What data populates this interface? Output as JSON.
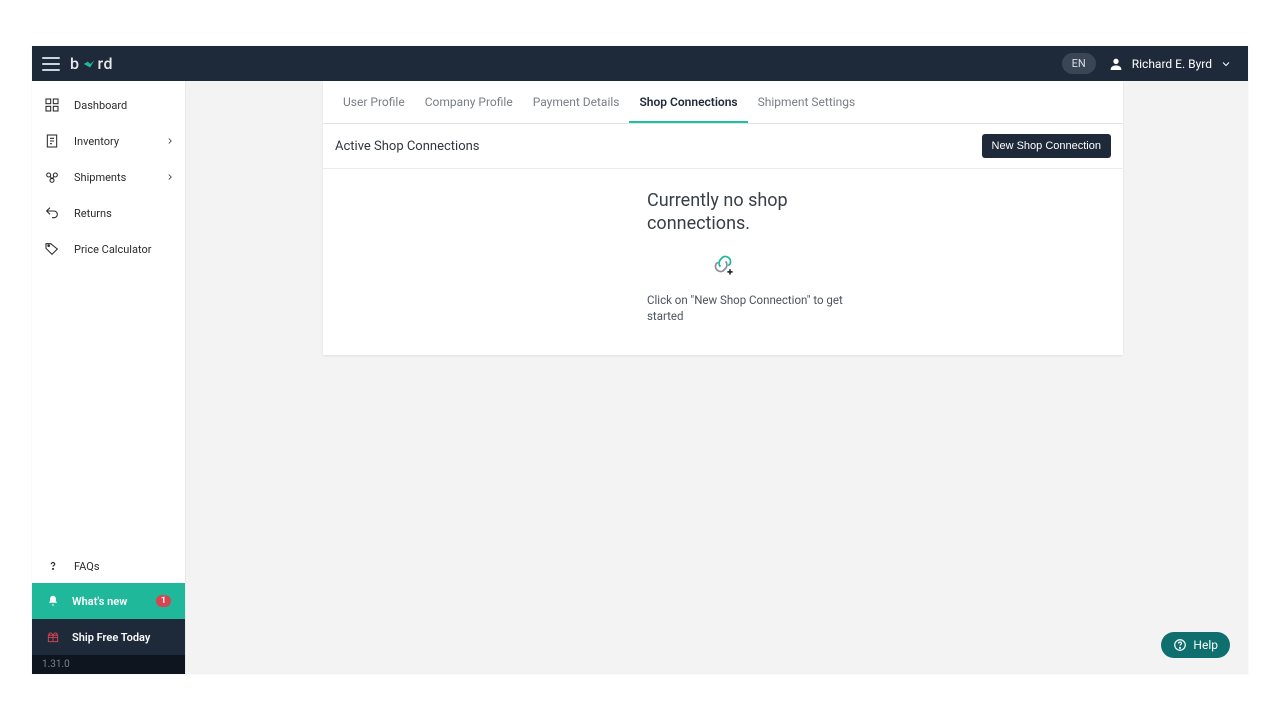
{
  "topbar": {
    "brand_prefix": "b",
    "brand_suffix": "rd",
    "language": "EN",
    "user_name": "Richard E. Byrd"
  },
  "sidebar": {
    "items": [
      {
        "label": "Dashboard",
        "icon": "dashboard-icon",
        "expandable": false
      },
      {
        "label": "Inventory",
        "icon": "inventory-icon",
        "expandable": true
      },
      {
        "label": "Shipments",
        "icon": "shipments-icon",
        "expandable": true
      },
      {
        "label": "Returns",
        "icon": "returns-icon",
        "expandable": false
      },
      {
        "label": "Price Calculator",
        "icon": "tag-icon",
        "expandable": false
      }
    ],
    "faqs_label": "FAQs",
    "whats_new_label": "What's new",
    "whats_new_badge": "1",
    "ship_free_label": "Ship Free Today",
    "version": "1.31.0"
  },
  "tabs": [
    {
      "label": "User Profile",
      "active": false
    },
    {
      "label": "Company Profile",
      "active": false
    },
    {
      "label": "Payment Details",
      "active": false
    },
    {
      "label": "Shop Connections",
      "active": true
    },
    {
      "label": "Shipment Settings",
      "active": false
    }
  ],
  "section": {
    "title": "Active Shop Connections",
    "new_button": "New Shop Connection",
    "empty_title": "Currently no shop connections.",
    "empty_sub": "Click on \"New Shop Connection\" to get started"
  },
  "help": {
    "label": "Help"
  }
}
